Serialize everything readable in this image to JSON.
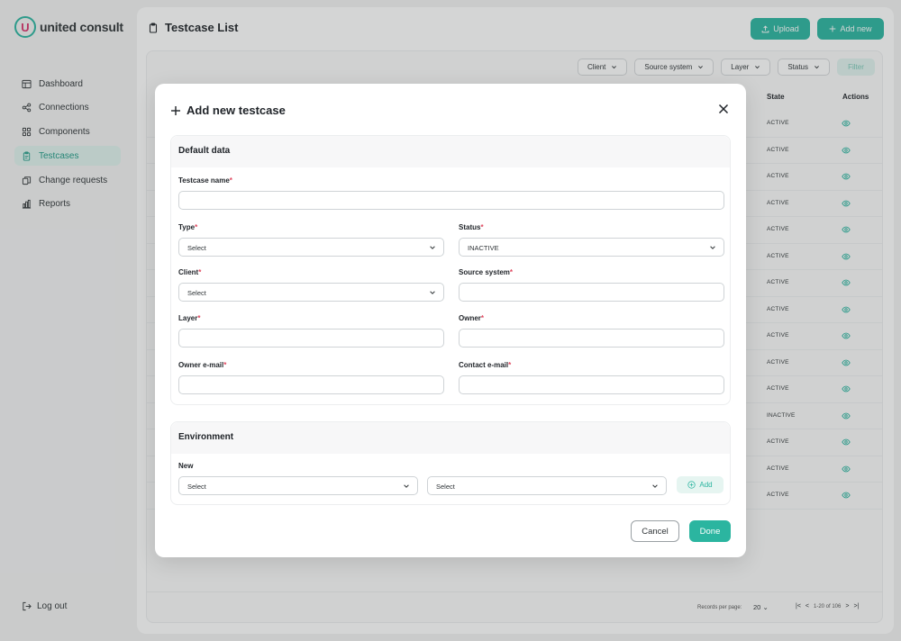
{
  "brand": {
    "logo_letter": "U",
    "name": "united consult"
  },
  "sidebar": {
    "items": [
      {
        "label": "Dashboard",
        "icon": "dashboard-icon",
        "active": false
      },
      {
        "label": "Connections",
        "icon": "connections-icon",
        "active": false
      },
      {
        "label": "Components",
        "icon": "components-icon",
        "active": false
      },
      {
        "label": "Testcases",
        "icon": "testcases-icon",
        "active": true
      },
      {
        "label": "Change requests",
        "icon": "change-requests-icon",
        "active": false
      },
      {
        "label": "Reports",
        "icon": "reports-icon",
        "active": false
      }
    ],
    "logout_label": "Log out"
  },
  "header": {
    "title": "Testcase List",
    "upload_label": "Upload",
    "add_new_label": "Add new"
  },
  "filters": {
    "client": "Client",
    "source_system": "Source system",
    "layer": "Layer",
    "status": "Status",
    "apply": "Filter"
  },
  "table": {
    "columns": {
      "state": "State",
      "actions": "Actions"
    },
    "rows": [
      "ACTIVE",
      "ACTIVE",
      "ACTIVE",
      "ACTIVE",
      "ACTIVE",
      "ACTIVE",
      "ACTIVE",
      "ACTIVE",
      "ACTIVE",
      "ACTIVE",
      "ACTIVE",
      "INACTIVE",
      "ACTIVE",
      "ACTIVE",
      "ACTIVE"
    ]
  },
  "pagination": {
    "records_label": "Records per page:",
    "page_size": "20",
    "range": "1-20 of 106"
  },
  "modal": {
    "title": "Add new testcase",
    "default_section": {
      "title": "Default data",
      "testcase_name_label": "Testcase name",
      "type_label": "Type",
      "type_value": "Select",
      "status_label": "Status",
      "status_value": "INACTIVE",
      "client_label": "Client",
      "client_value": "Select",
      "source_system_label": "Source system",
      "layer_label": "Layer",
      "owner_label": "Owner",
      "owner_email_label": "Owner e-mail",
      "contact_email_label": "Contact e-mail",
      "required_mark": "*"
    },
    "environment_section": {
      "title": "Environment",
      "new_label": "New",
      "select1_value": "Select",
      "select2_value": "Select",
      "add_label": "Add"
    },
    "cancel_label": "Cancel",
    "done_label": "Done"
  },
  "colors": {
    "accent": "#2bb5a0",
    "accent_light": "#e6f5f1",
    "required": "#e0485f"
  }
}
